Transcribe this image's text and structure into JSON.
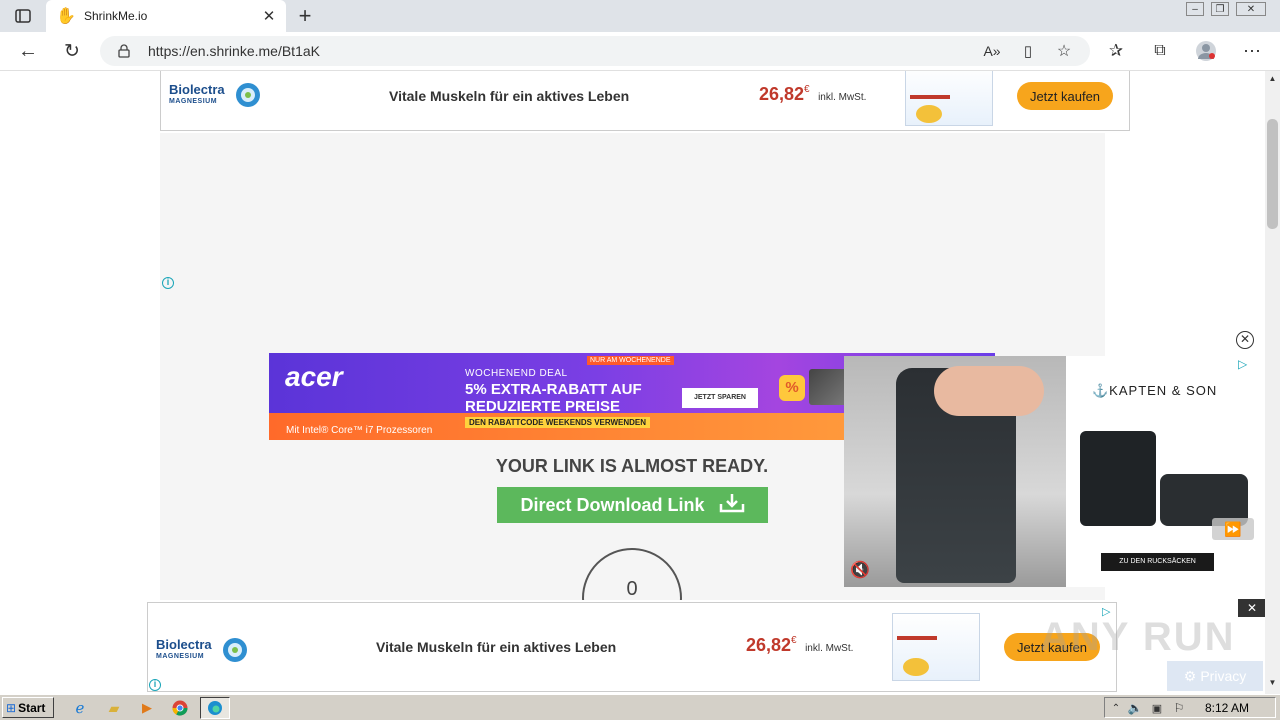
{
  "browser": {
    "tab_title": "ShrinkMe.io",
    "url": "https://en.shrinke.me/Bt1aK",
    "icons": [
      "sidebar-toggle-icon",
      "tab-close-icon",
      "new-tab-icon",
      "back-icon",
      "refresh-icon",
      "lock-icon",
      "read-aloud-icon",
      "immersive-reader-icon",
      "add-favorite-icon",
      "favorites-icon",
      "collections-icon",
      "profile-icon",
      "more-icon",
      "minimize-icon",
      "restore-icon",
      "close-window-icon"
    ]
  },
  "top_ad": {
    "brand": "Biolectra",
    "brand_sub": "MAGNESIUM",
    "headline": "Vitale Muskeln für ein aktives Leben",
    "price": "26,82",
    "currency": "€",
    "tax": "inkl. MwSt.",
    "cta": "Jetzt kaufen"
  },
  "acer_ad": {
    "logo": "acer",
    "deal": "WOCHENEND DEAL",
    "tag": "NUR AM WOCHENENDE",
    "line1": "5% EXTRA-RABATT AUF",
    "line2": "REDUZIERTE PREISE",
    "cta": "JETZT SPAREN",
    "code": "DEN RABATTCODE WEEKENDS VERWENDEN",
    "footer": "Mit Intel® Core™ i7 Prozessoren"
  },
  "main": {
    "heading": "YOUR LINK IS ALMOST READY.",
    "download_label": "Direct Download Link",
    "countdown": "0"
  },
  "video_ad": {
    "brand": "⚓KAPTEN & SON",
    "cta": "ZU DEN RUCKSÄCKEN"
  },
  "bottom_ad": {
    "brand": "Biolectra",
    "brand_sub": "MAGNESIUM",
    "headline": "Vitale Muskeln für ein aktives Leben",
    "price": "26,82",
    "currency": "€",
    "tax": "inkl. MwSt.",
    "cta": "Jetzt kaufen"
  },
  "watermark": {
    "text": "ANY RUN",
    "privacy": "Privacy"
  },
  "taskbar": {
    "start": "Start",
    "time": "8:12 AM"
  },
  "colors": {
    "download_green": "#5cb85c",
    "price_red": "#c0392b",
    "buy_orange": "#f7a51c",
    "acer_purple": "#6a3de8"
  }
}
